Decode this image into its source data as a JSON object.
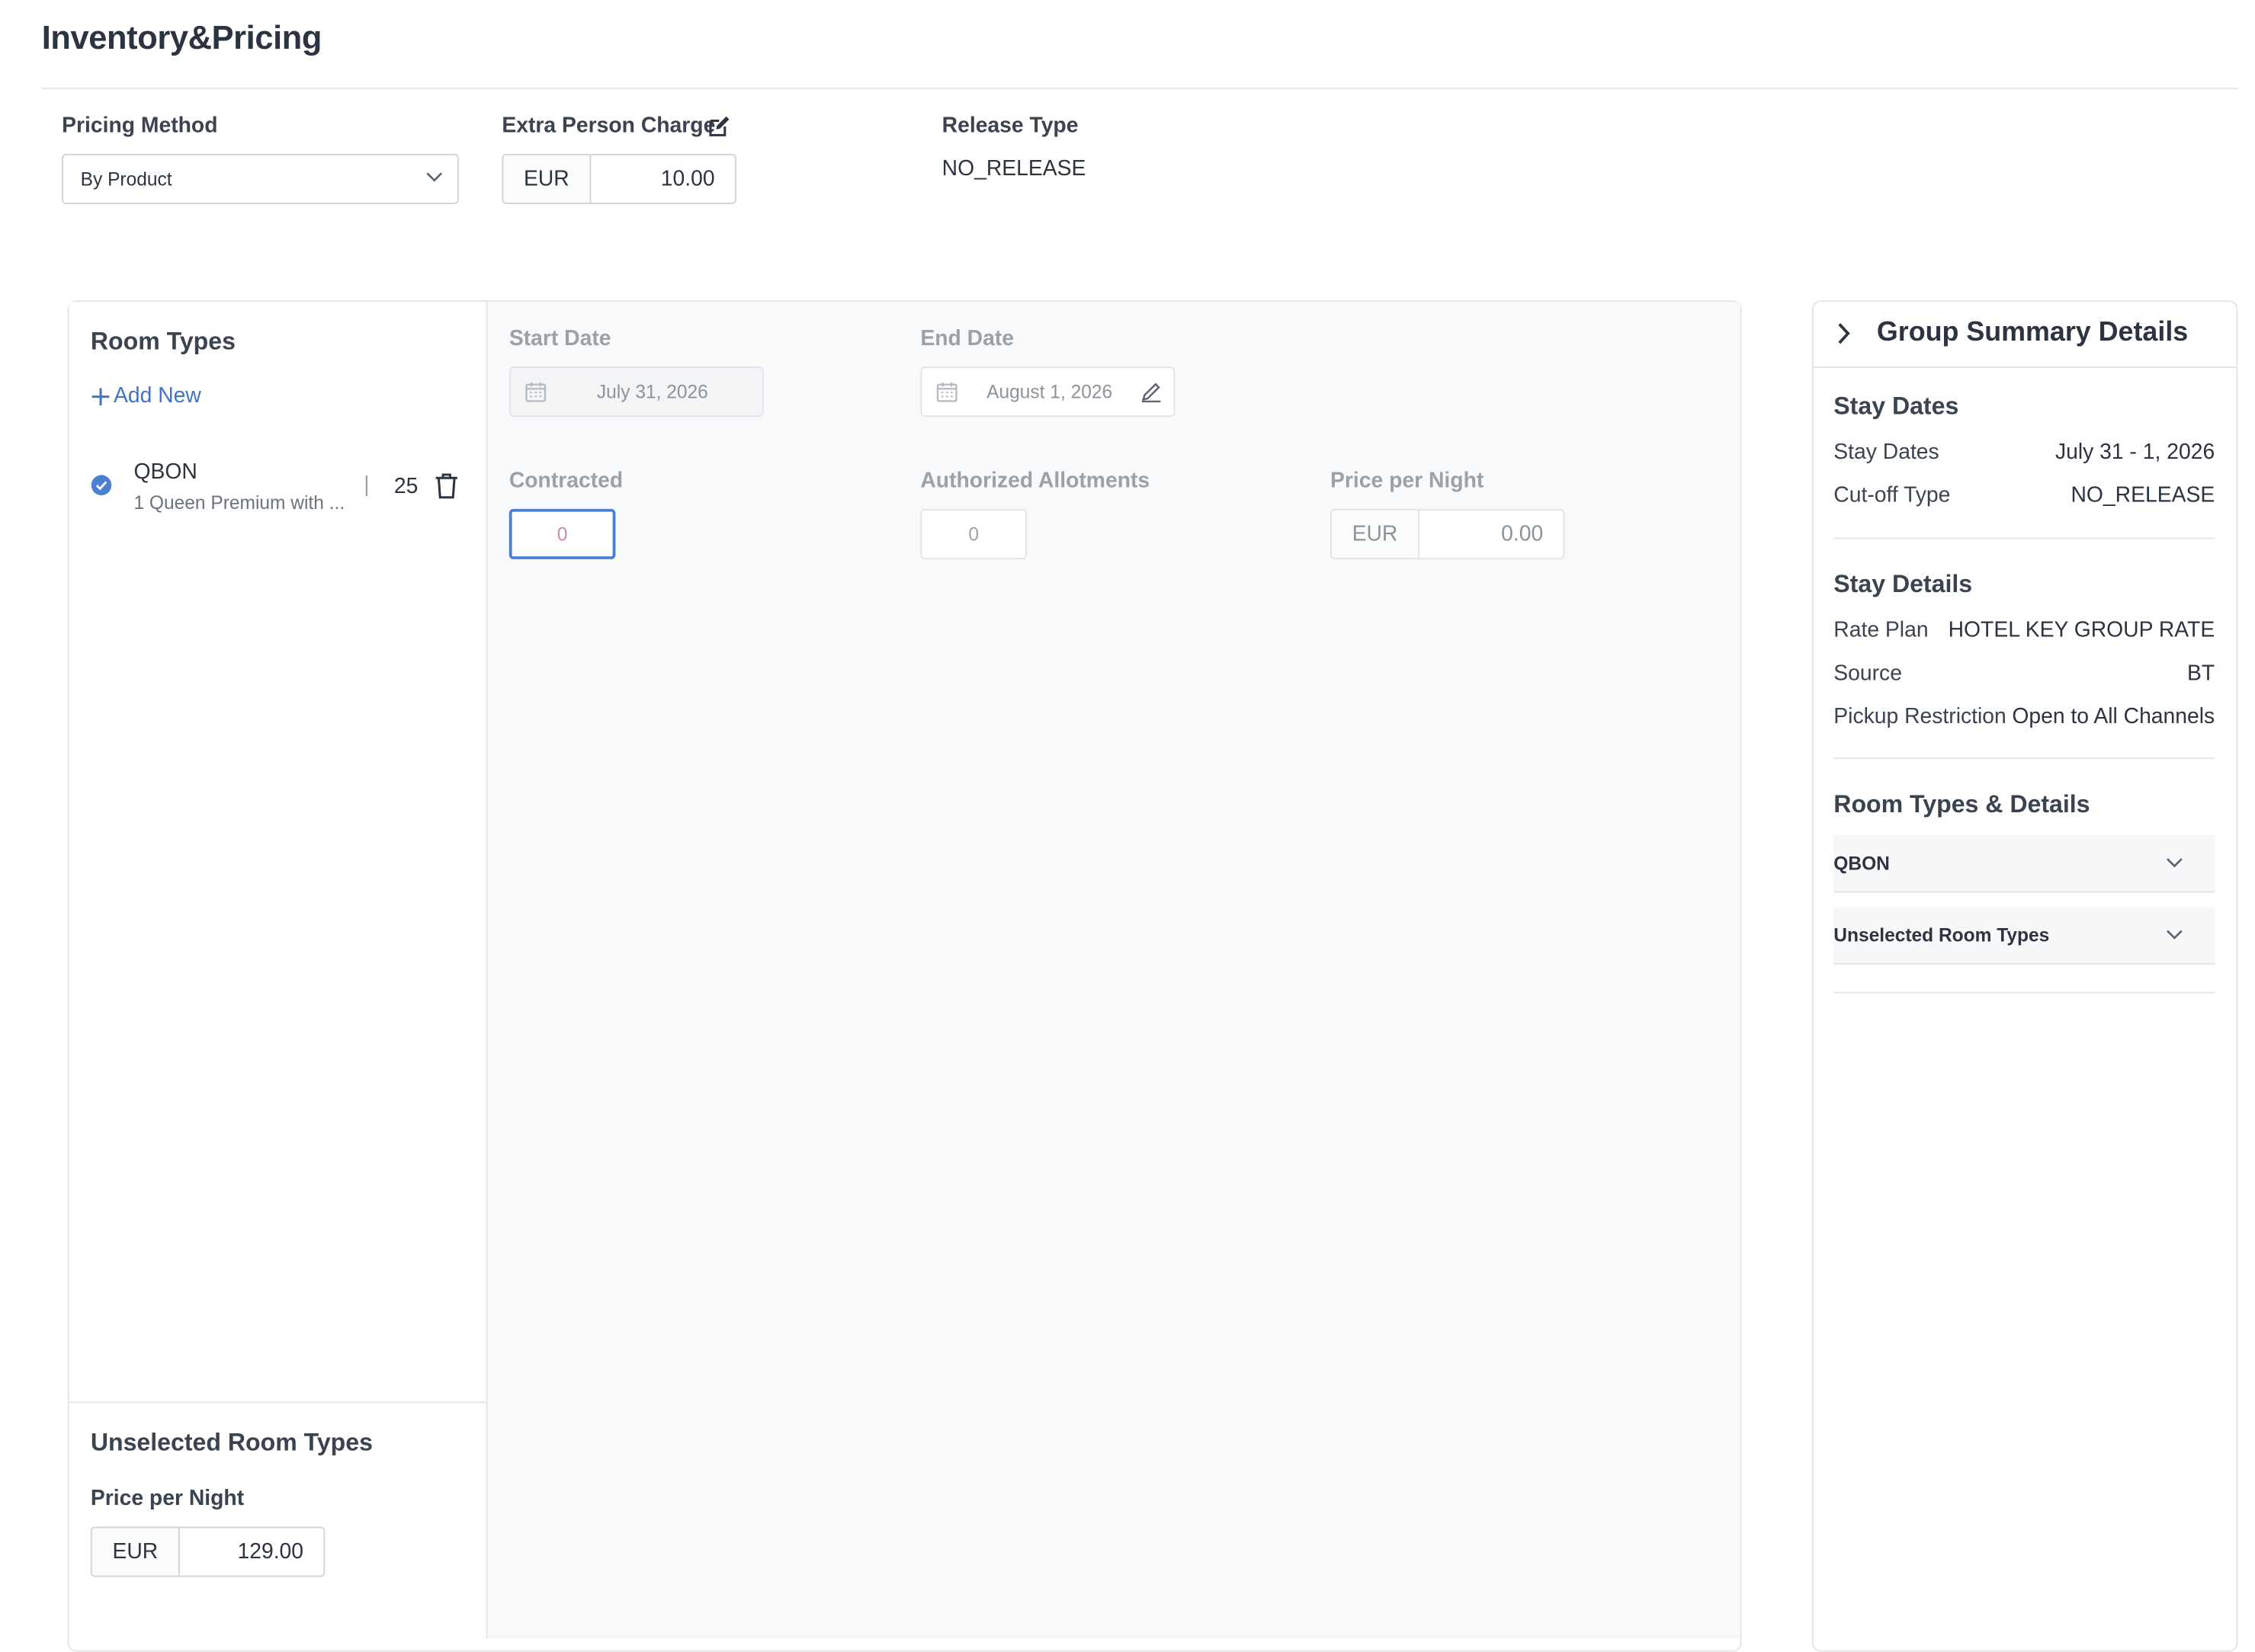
{
  "page": {
    "title": "Inventory&Pricing"
  },
  "settings": {
    "pricing_method_label": "Pricing Method",
    "pricing_method_value": "By Product",
    "extra_person_label": "Extra Person Charge",
    "extra_person_currency": "EUR",
    "extra_person_amount": "10.00",
    "release_type_label": "Release Type",
    "release_type_value": "NO_RELEASE"
  },
  "room_types": {
    "heading": "Room Types",
    "add_new": "Add New",
    "items": [
      {
        "code": "QBON",
        "description": "1 Queen Premium with ...",
        "count": "25",
        "selected": true
      }
    ]
  },
  "unselected": {
    "heading": "Unselected Room Types",
    "price_label": "Price per Night",
    "currency": "EUR",
    "amount": "129.00"
  },
  "detail": {
    "start_date_label": "Start Date",
    "start_date": "July 31, 2026",
    "end_date_label": "End Date",
    "end_date": "August 1, 2026",
    "contracted_label": "Contracted",
    "contracted_value": "0",
    "allotments_label": "Authorized Allotments",
    "allotments_value": "0",
    "price_label": "Price per Night",
    "price_currency": "EUR",
    "price_amount": "0.00"
  },
  "summary": {
    "title": "Group Summary Details",
    "stay_dates": {
      "heading": "Stay Dates",
      "rows": [
        {
          "key": "Stay Dates",
          "value": "July 31 - 1, 2026"
        },
        {
          "key": "Cut-off Type",
          "value": "NO_RELEASE"
        }
      ]
    },
    "stay_details": {
      "heading": "Stay Details",
      "rows": [
        {
          "key": "Rate Plan",
          "value": "HOTEL KEY GROUP RATE"
        },
        {
          "key": "Source",
          "value": "BT"
        },
        {
          "key": "Pickup Restriction",
          "value": "Open to All Channels"
        }
      ]
    },
    "room_details": {
      "heading": "Room Types & Details",
      "items": [
        {
          "label": "QBON"
        },
        {
          "label": "Unselected Room Types"
        }
      ]
    }
  },
  "colors": {
    "accent": "#3f74c9",
    "focus": "#4a7fd4",
    "panel_bg": "#f8f9fa"
  }
}
